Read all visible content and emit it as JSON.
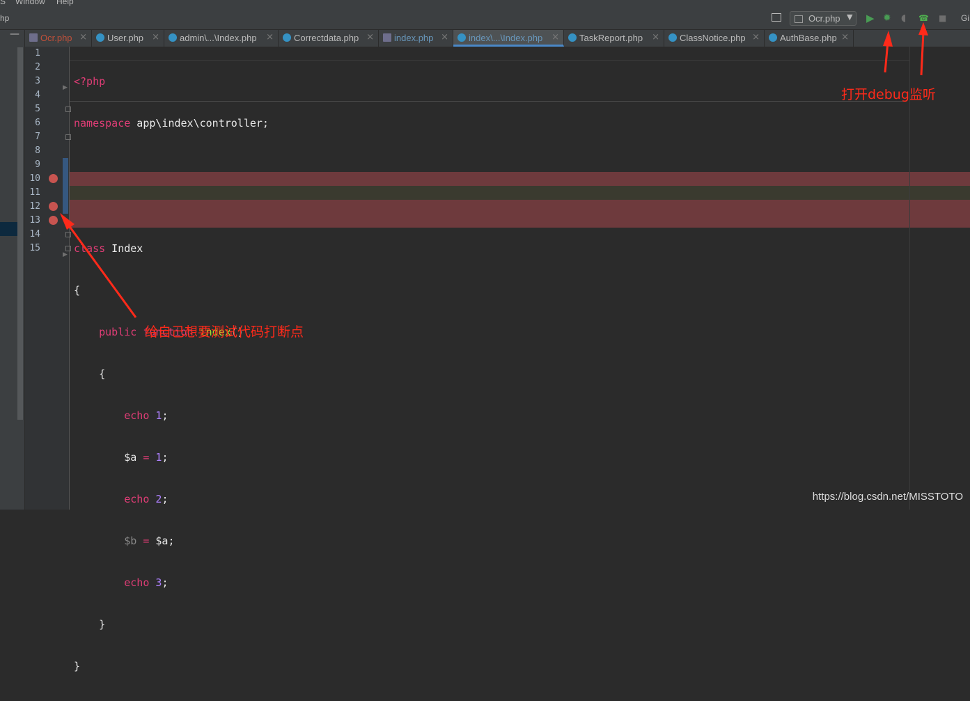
{
  "menu": {
    "partial_left": "S",
    "window": "Window",
    "help": "Help"
  },
  "toolbar": {
    "partial_left": "hp",
    "run_config": "Ocr.php",
    "git_partial": "Gi"
  },
  "tabs": [
    {
      "label": "Ocr.php",
      "color": "#c0503a",
      "icon": "php-file-icon"
    },
    {
      "label": "User.php",
      "color": "#bbbbbb",
      "icon": "php-class-icon"
    },
    {
      "label": "admin\\...\\Index.php",
      "color": "#bbbbbb",
      "icon": "php-class-icon"
    },
    {
      "label": "Correctdata.php",
      "color": "#bbbbbb",
      "icon": "php-class-icon"
    },
    {
      "label": "index.php",
      "color": "#6897bb",
      "icon": "php-file-icon"
    },
    {
      "label": "index\\...\\Index.php",
      "color": "#6897bb",
      "icon": "php-class-icon",
      "active": true
    },
    {
      "label": "TaskReport.php",
      "color": "#bbbbbb",
      "icon": "php-class-icon"
    },
    {
      "label": "ClassNotice.php",
      "color": "#bbbbbb",
      "icon": "php-class-icon"
    },
    {
      "label": "AuthBase.php",
      "color": "#bbbbbb",
      "icon": "php-class-icon"
    }
  ],
  "editor": {
    "line_numbers": [
      "1",
      "2",
      "3",
      "4",
      "5",
      "6",
      "7",
      "8",
      "9",
      "10",
      "11",
      "12",
      "13",
      "14",
      "15"
    ],
    "code": {
      "l1": "<?php",
      "l2_kw": "namespace",
      "l2_rest": " app\\index\\controller;",
      "l5_kw": "class",
      "l5_rest": " Index",
      "l6": "{",
      "l7_kw1": "public",
      "l7_kw2": "function",
      "l7_fn": "index",
      "l7_rest": "()",
      "l8": "{",
      "echo": "echo",
      "v1": "1",
      "v2": "2",
      "v3": "3",
      "var_a": "$a",
      "var_b": "$b",
      "eq": "=",
      "semi": ";",
      "l14": "}",
      "l15": "}"
    },
    "breakpoint_lines": [
      10,
      12,
      13
    ],
    "breakpoint_color": "#c75450",
    "highlight_color": "#6e3a3d"
  },
  "annotations": {
    "debug_listen": "打开debug监听",
    "set_breakpoints": "给自己想要测试代码打断点",
    "color": "#ff2a1a"
  },
  "watermark": "https://blog.csdn.net/MISSTOTO"
}
